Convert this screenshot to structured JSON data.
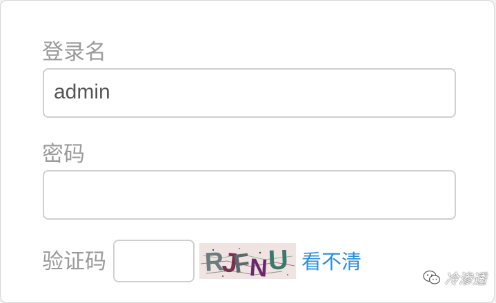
{
  "form": {
    "username": {
      "label": "登录名",
      "value": "admin"
    },
    "password": {
      "label": "密码",
      "value": ""
    },
    "captcha": {
      "label": "验证码",
      "value": "",
      "image_text": "RJFNU",
      "refresh_link": "看不清"
    }
  },
  "watermark": {
    "text": "冷渗透",
    "icon": "wechat-icon"
  },
  "colors": {
    "label": "#9a9a9a",
    "link": "#2f8fd6",
    "border": "#cfcfcf"
  }
}
